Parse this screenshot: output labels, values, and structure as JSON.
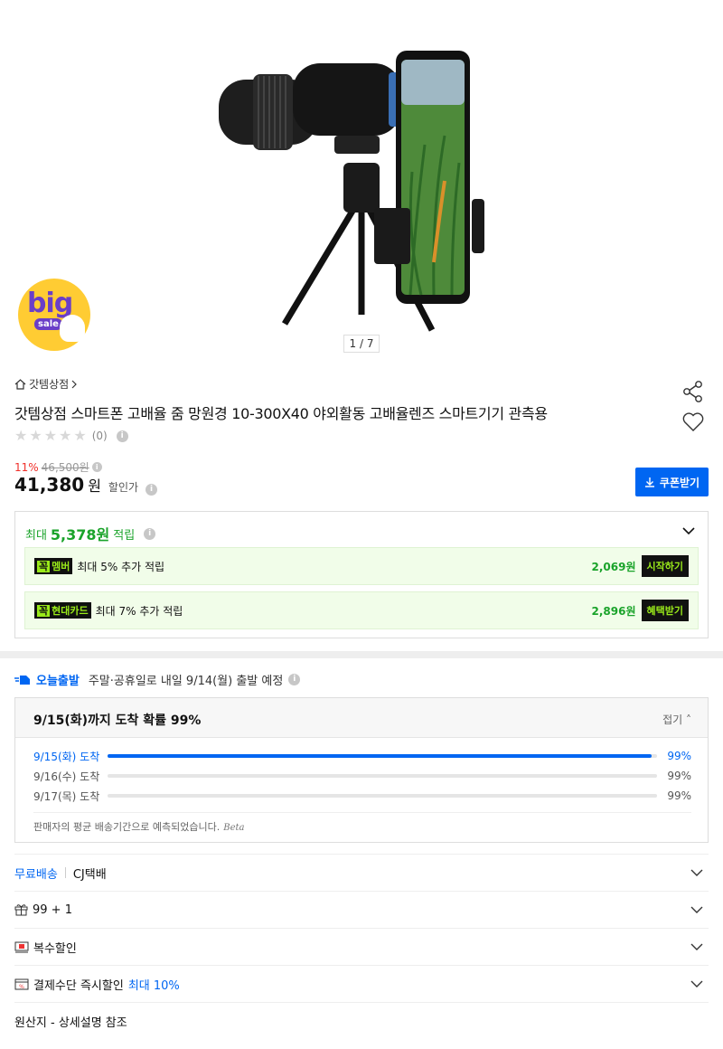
{
  "hero": {
    "badge_big": "big",
    "badge_sale": "sale",
    "page_indicator": "1 / 7"
  },
  "store": {
    "name": "갓템상점"
  },
  "product": {
    "title": "갓템상점 스마트폰 고배율 줌 망원경 10-300X40 야외활동 고배율렌즈 스마트기기 관측용",
    "review_count": "(0)",
    "discount_rate": "11%",
    "original_price": "46,500원",
    "price": "41,380",
    "price_unit": "원",
    "price_label": "할인가"
  },
  "coupon": {
    "label": "쿠폰받기"
  },
  "points": {
    "prefix": "최대",
    "amount": "5,378원",
    "suffix": "적립",
    "promos": [
      {
        "tag_mark": "꼭",
        "tag": "멤버",
        "text": "최대 5% 추가 적립",
        "amount": "2,069원",
        "button": "시작하기"
      },
      {
        "tag_mark": "꼭",
        "tag": "현대카드",
        "text": "최대 7% 추가 적립",
        "amount": "2,896원",
        "button": "혜택받기"
      }
    ]
  },
  "delivery": {
    "today_label": "오늘출발",
    "today_text": "주말·공휴일로 내일 9/14(월) 출발 예정",
    "headline": "9/15(화)까지 도착 확률 99%",
    "fold_label": "접기",
    "rows": [
      {
        "date": "9/15(화) 도착",
        "percent": "99%",
        "fill": 0.99,
        "active": true
      },
      {
        "date": "9/16(수) 도착",
        "percent": "99%",
        "fill": 0,
        "active": false
      },
      {
        "date": "9/17(목) 도착",
        "percent": "99%",
        "fill": 0,
        "active": false
      }
    ],
    "note": "판매자의 평균 배송기간으로 예측되었습니다.",
    "note_beta": "Beta"
  },
  "shipping": {
    "free": "무료배송",
    "carrier": "CJ택배"
  },
  "gift": {
    "text": "99 + 1"
  },
  "multi_discount": {
    "text": "복수할인"
  },
  "payment": {
    "text": "결제수단 즉시할인",
    "highlight": "최대 10%"
  },
  "origin": {
    "text": "원산지 - 상세설명 참조"
  },
  "colors": {
    "accent_blue": "#0066f2",
    "points_green": "#1aa32a",
    "discount_red": "#f0302a"
  }
}
